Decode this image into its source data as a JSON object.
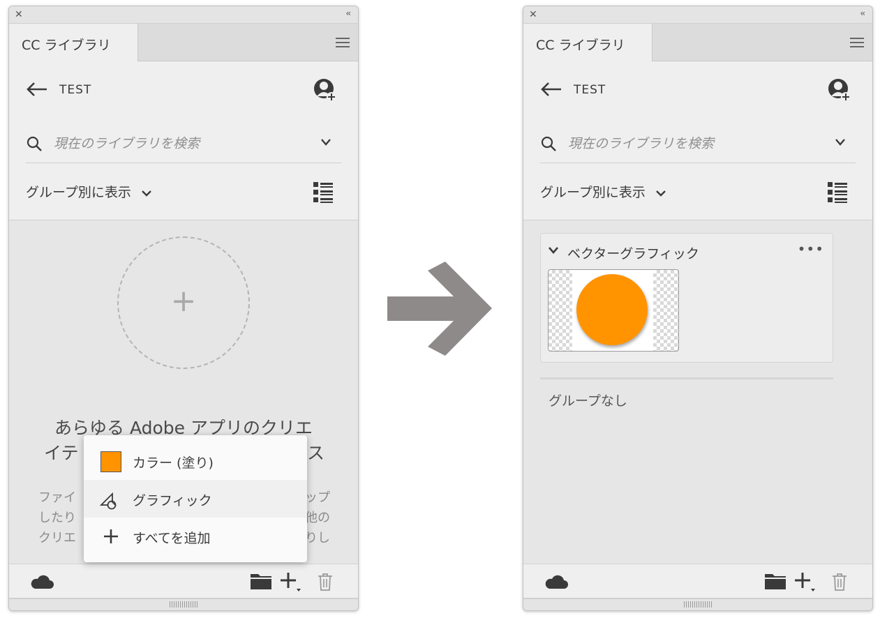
{
  "left_panel": {
    "tab_label": "CC ライブラリ",
    "library_name": "TEST",
    "search_placeholder": "現在のライブラリを検索",
    "group_view_label": "グループ別に表示",
    "empty_state": {
      "plus": "+",
      "title_line1": "あらゆる Adobe アプリのクリエ",
      "title_line2": "イテ",
      "title_line2_end": "ス",
      "body_line1_start": "ファイ",
      "body_line1_end": "ップ",
      "body_line2_start": "したり",
      "body_line2_end": "他の",
      "body_line3_start": "クリエ",
      "body_line3_end": "りし"
    },
    "add_menu": {
      "items": [
        {
          "label": "カラー (塗り)",
          "icon": "color-swatch-icon",
          "color": "#ff9400"
        },
        {
          "label": "グラフィック",
          "icon": "graphic-icon"
        },
        {
          "label": "すべてを追加",
          "icon": "plus-icon"
        }
      ]
    }
  },
  "right_panel": {
    "tab_label": "CC ライブラリ",
    "library_name": "TEST",
    "search_placeholder": "現在のライブラリを検索",
    "group_view_label": "グループ別に表示",
    "group": {
      "title": "ベクターグラフィック",
      "more": "•••",
      "item_color": "#ff9400"
    },
    "no_group_label": "グループなし"
  },
  "symbols": {
    "close": "✕",
    "collapse": "‹‹"
  },
  "colors": {
    "accent_orange": "#ff9400",
    "arrow_gray": "#8f8a8a"
  }
}
